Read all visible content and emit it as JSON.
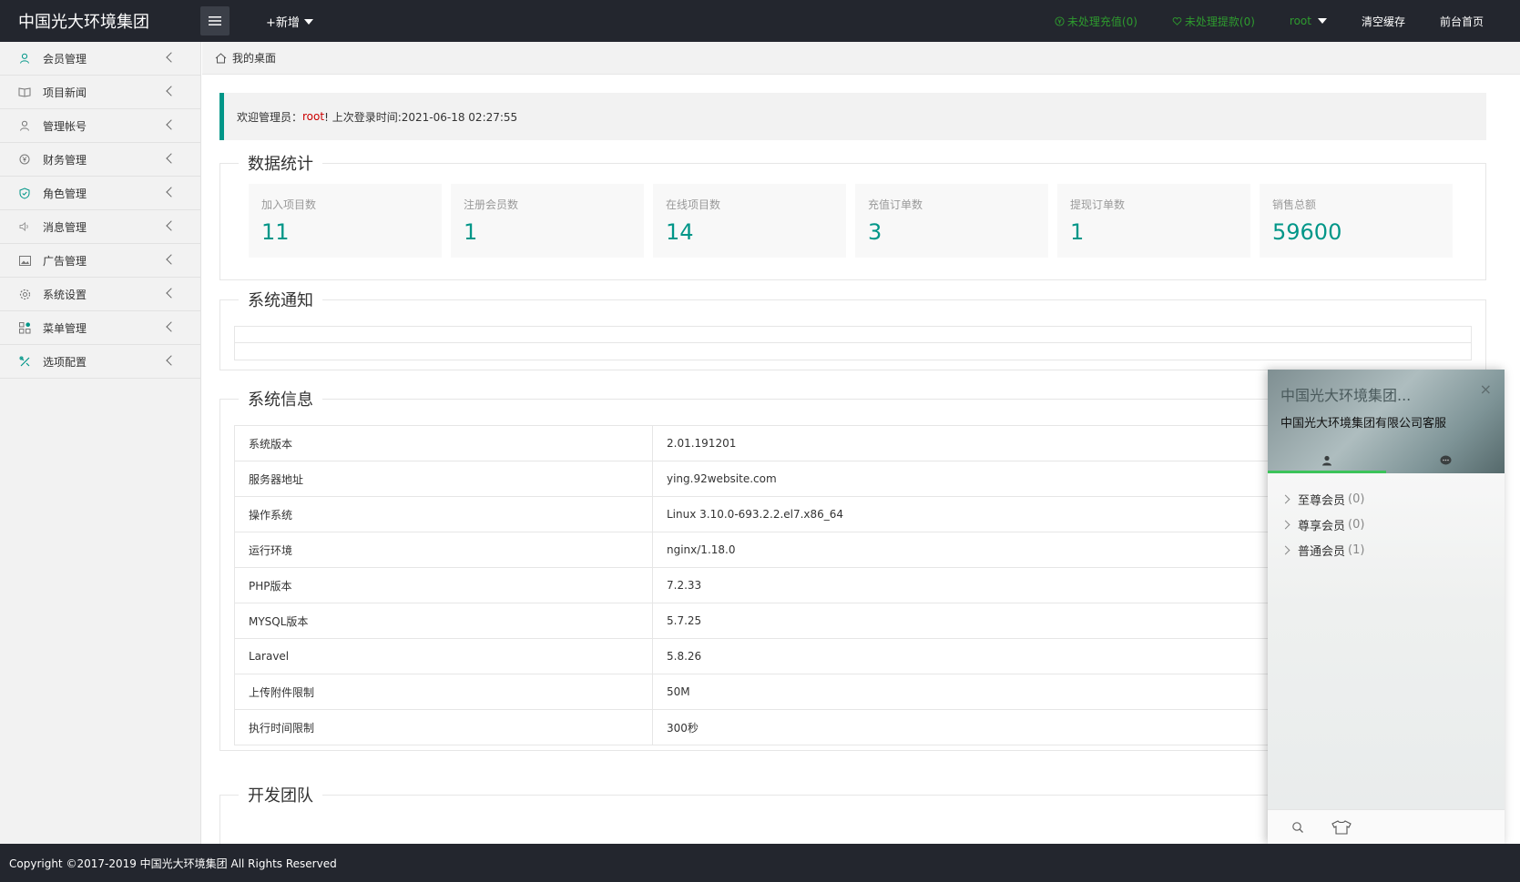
{
  "header": {
    "logo": "中国光大环境集团",
    "add_new": "+新增",
    "pending_recharge": "未处理充值(0)",
    "pending_withdraw": "未处理提款(0)",
    "user": "root",
    "clear_cache": "清空缓存",
    "front_home": "前台首页"
  },
  "sidebar": {
    "items": [
      {
        "label": "会员管理",
        "icon": "user-icon"
      },
      {
        "label": "项目新闻",
        "icon": "book-icon"
      },
      {
        "label": "管理帐号",
        "icon": "account-icon"
      },
      {
        "label": "财务管理",
        "icon": "yen-icon"
      },
      {
        "label": "角色管理",
        "icon": "shield-icon"
      },
      {
        "label": "消息管理",
        "icon": "speaker-icon"
      },
      {
        "label": "广告管理",
        "icon": "picture-icon"
      },
      {
        "label": "系统设置",
        "icon": "gear-icon"
      },
      {
        "label": "菜单管理",
        "icon": "grid-icon"
      },
      {
        "label": "选项配置",
        "icon": "tools-icon"
      }
    ]
  },
  "breadcrumb": {
    "label": "我的桌面"
  },
  "welcome": {
    "prefix": "欢迎管理员：",
    "user": "root",
    "suffix": "! 上次登录时间:2021-06-18 02:27:55"
  },
  "stats": {
    "legend": "数据统计",
    "cards": [
      {
        "title": "加入项目数",
        "value": "11"
      },
      {
        "title": "注册会员数",
        "value": "1"
      },
      {
        "title": "在线项目数",
        "value": "14"
      },
      {
        "title": "充值订单数",
        "value": "3"
      },
      {
        "title": "提现订单数",
        "value": "1"
      },
      {
        "title": "销售总额",
        "value": "59600"
      }
    ]
  },
  "notice": {
    "legend": "系统通知"
  },
  "sysinfo": {
    "legend": "系统信息",
    "rows": [
      {
        "key": "系统版本",
        "value": "2.01.191201"
      },
      {
        "key": "服务器地址",
        "value": "ying.92website.com"
      },
      {
        "key": "操作系统",
        "value": "Linux 3.10.0-693.2.2.el7.x86_64"
      },
      {
        "key": "运行环境",
        "value": "nginx/1.18.0"
      },
      {
        "key": "PHP版本",
        "value": "7.2.33"
      },
      {
        "key": "MYSQL版本",
        "value": "5.7.25"
      },
      {
        "key": "Laravel",
        "value": "5.8.26"
      },
      {
        "key": "上传附件限制",
        "value": "50M"
      },
      {
        "key": "执行时间限制",
        "value": "300秒"
      }
    ]
  },
  "team": {
    "legend": "开发团队"
  },
  "chat": {
    "title": "中国光大环境集团...",
    "subtitle": "中国光大环境集团有限公司客服",
    "close": "×",
    "groups": [
      {
        "name": "至尊会员",
        "count": "(0)"
      },
      {
        "name": "尊享会员",
        "count": "(0)"
      },
      {
        "name": "普通会员",
        "count": "(1)"
      }
    ]
  },
  "footer": {
    "copyright": "Copyright ©2017-2019 中国光大环境集团 All Rights Reserved"
  },
  "colors": {
    "accent": "#009688",
    "header_bg": "#23262e",
    "alert_green": "#2e9b2e",
    "username_red": "#cc0000"
  }
}
